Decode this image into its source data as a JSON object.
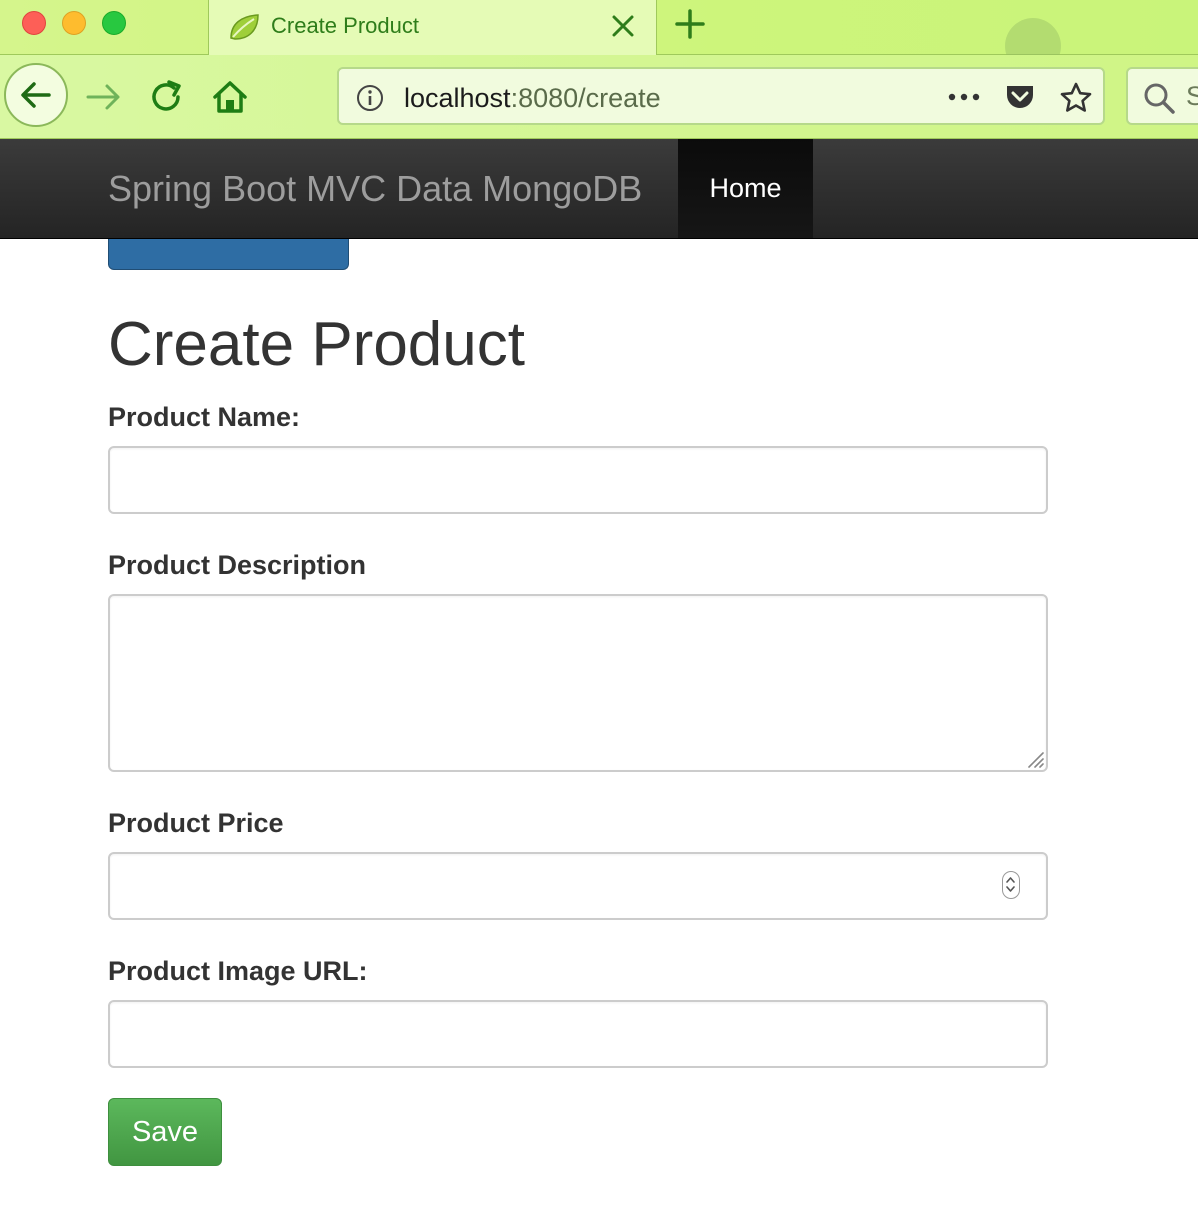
{
  "browser": {
    "tab": {
      "title": "Create Product",
      "favicon": "spring-leaf-icon"
    },
    "address_bar": {
      "host": "localhost",
      "path": ":8080/create"
    },
    "search": {
      "placeholder_partial": "S"
    },
    "colors": {
      "chrome_green": "#cff585",
      "icon_green": "#2e7d1a"
    }
  },
  "site": {
    "brand": "Spring Boot MVC Data MongoDB",
    "nav": {
      "home_label": "Home"
    }
  },
  "page": {
    "title": "Create Product"
  },
  "form": {
    "name_label": "Product Name:",
    "name_value": "",
    "description_label": "Product Description",
    "description_value": "",
    "price_label": "Product Price",
    "price_value": "",
    "image_url_label": "Product Image URL:",
    "image_url_value": "",
    "save_label": "Save",
    "save_color": "#5cb85c"
  }
}
